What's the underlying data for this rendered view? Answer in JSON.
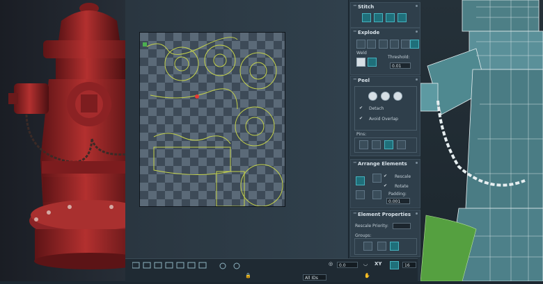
{
  "panel": {
    "stitch": {
      "title": "Stitch"
    },
    "explode": {
      "title": "Explode",
      "weld_label": "Weld",
      "threshold_label": "Threshold:",
      "threshold_value": "0.01"
    },
    "peel": {
      "title": "Peel",
      "detach_label": "Detach",
      "avoid_overlap_label": "Avoid Overlap",
      "pins_label": "Pins:"
    },
    "arrange": {
      "title": "Arrange Elements",
      "rescale_label": "Rescale",
      "rotate_label": "Rotate",
      "padding_label": "Padding:",
      "padding_value": "0.001"
    },
    "element_props": {
      "title": "Element Properties",
      "rescale_priority_label": "Rescale Priority:",
      "groups_label": "Groups:"
    }
  },
  "toolbar": {
    "angle_value": "0.0",
    "xy_label": "XY",
    "count_value": "16",
    "filter_value": "All IDs"
  },
  "colors": {
    "accent_teal": "#46b3c0",
    "hydrant_red": "#a5282a",
    "uv_line": "#c7d44a"
  }
}
